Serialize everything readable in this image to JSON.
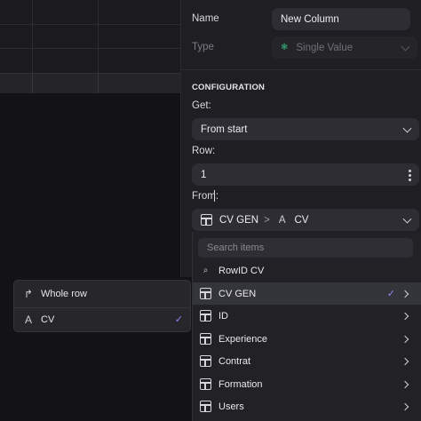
{
  "panel": {
    "name_label": "Name",
    "name_value": "New Column",
    "type_label": "Type",
    "type_value": "Single Value",
    "type_icon": "single-value-icon",
    "section_title": "CONFIGURATION",
    "get_label": "Get:",
    "get_value": "From start",
    "row_label": "Row:",
    "row_value": "1",
    "from_label": "From:",
    "from_table": "CV GEN",
    "from_separator": ">",
    "from_column_icon": "A",
    "from_column": "CV"
  },
  "left_popup": {
    "items": [
      {
        "icon": "↱",
        "label": "Whole row"
      },
      {
        "icon": "A",
        "label": "CV"
      }
    ]
  },
  "dropdown": {
    "search_placeholder": "Search items",
    "items": [
      {
        "label": "RowID CV",
        "icon": "rowid-search-icon"
      },
      {
        "label": "CV GEN",
        "icon": "table-icon",
        "selected": true
      },
      {
        "label": "ID",
        "icon": "table-icon"
      },
      {
        "label": "Experience",
        "icon": "table-icon"
      },
      {
        "label": "Contrat",
        "icon": "table-icon"
      },
      {
        "label": "Formation",
        "icon": "table-icon"
      },
      {
        "label": "Users",
        "icon": "table-icon"
      }
    ]
  },
  "colors": {
    "accent": "#8b8cf2",
    "panel_bg": "#1f1f23",
    "field_bg": "#2d2d33"
  }
}
